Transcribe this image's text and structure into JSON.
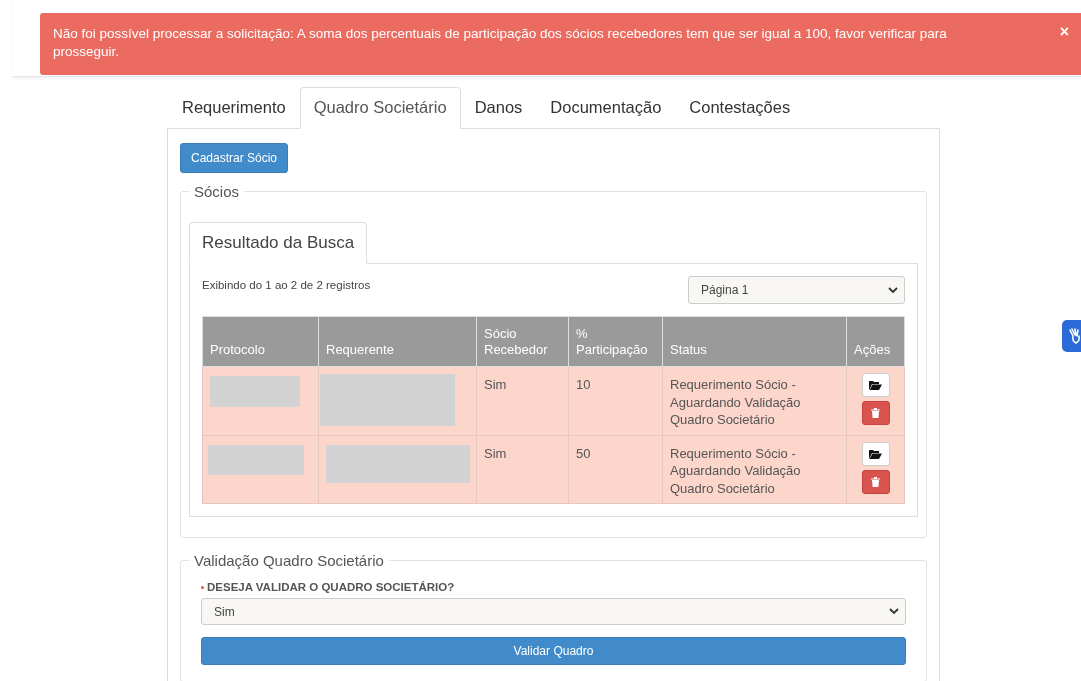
{
  "alert": {
    "message": "Não foi possível processar a solicitação: A soma dos percentuais de participação dos sócios recebedores tem que ser igual a 100, favor verificar para prosseguir.",
    "close": "×"
  },
  "tabs": [
    {
      "label": "Requerimento",
      "selected": false
    },
    {
      "label": "Quadro Societário",
      "selected": true
    },
    {
      "label": "Danos",
      "selected": false
    },
    {
      "label": "Documentação",
      "selected": false
    },
    {
      "label": "Contestações",
      "selected": false
    }
  ],
  "add_button": "Cadastrar Sócio",
  "partners": {
    "legend": "Sócios",
    "result_tabs": [
      {
        "label": "Resultado da Busca",
        "selected": true
      }
    ],
    "summary": "Exibindo do 1 ao 2 de 2 registros",
    "page_select": "Página 1",
    "columns": [
      "Protocolo",
      "Requerente",
      "Sócio Recebedor",
      "% Participação",
      "Status",
      "Ações"
    ],
    "rows": [
      {
        "highlighted": true,
        "receiver": "Sim",
        "share": "10",
        "status": "Requerimento Sócio - Aguardando Validação Quadro Societário"
      },
      {
        "highlighted": true,
        "receiver": "Sim",
        "share": "50",
        "status": "Requerimento Sócio - Aguardando Validação Quadro Societário"
      }
    ]
  },
  "validation": {
    "legend": "Validação Quadro Societário",
    "required": true,
    "question": "DESEJA VALIDAR O QUADRO SOCIETÁRIO?",
    "answer": "Sim",
    "submit": "Validar Quadro"
  }
}
